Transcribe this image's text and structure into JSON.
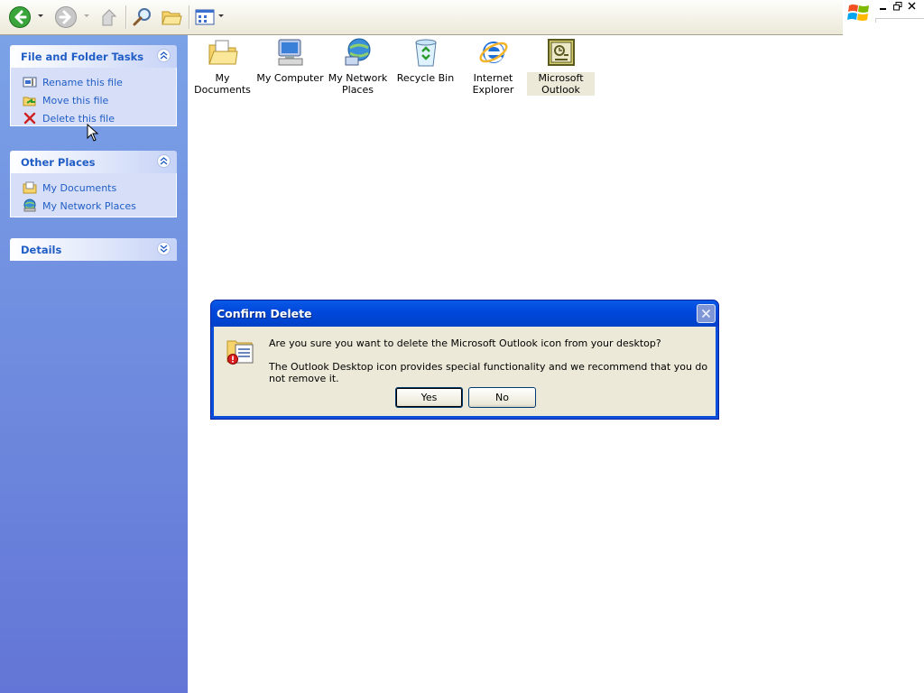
{
  "toolbar": {
    "buttons": [
      "back-icon",
      "forward-icon",
      "up-folder-icon",
      "search-icon",
      "folders-icon",
      "views-icon"
    ]
  },
  "colors": {
    "taskpane_top": "#7ba2e7",
    "taskpane_bottom": "#6375d6",
    "panel_title": "#215dc6",
    "dialog_title": "#0054e3",
    "dialog_body": "#ece9d8"
  },
  "taskpane": {
    "file_tasks": {
      "title": "File and Folder Tasks",
      "items": [
        {
          "label": "Rename this file",
          "icon": "rename-icon"
        },
        {
          "label": "Move this file",
          "icon": "move-icon"
        },
        {
          "label": "Delete this file",
          "icon": "delete-icon"
        }
      ]
    },
    "other_places": {
      "title": "Other Places",
      "items": [
        {
          "label": "My Documents",
          "icon": "my-documents-icon"
        },
        {
          "label": "My Network Places",
          "icon": "network-places-icon"
        }
      ]
    },
    "details": {
      "title": "Details"
    }
  },
  "desktop": {
    "icons": [
      {
        "line1": "My Documents",
        "line2": "",
        "icon": "my-documents-folder-icon"
      },
      {
        "line1": "My Computer",
        "line2": "",
        "icon": "my-computer-icon"
      },
      {
        "line1": "My Network",
        "line2": "Places",
        "icon": "network-places-icon"
      },
      {
        "line1": "Recycle Bin",
        "line2": "",
        "icon": "recycle-bin-icon"
      },
      {
        "line1": "Internet",
        "line2": "Explorer",
        "icon": "internet-explorer-icon"
      },
      {
        "line1": "Microsoft",
        "line2": "Outlook",
        "icon": "outlook-icon",
        "selected": true
      }
    ]
  },
  "dialog": {
    "title": "Confirm Delete",
    "message": "Are you sure you want to delete the Microsoft Outlook icon from your desktop?",
    "detail": "The Outlook Desktop icon provides special functionality and we recommend that you do not remove it.",
    "yes_label": "Yes",
    "no_label": "No"
  }
}
